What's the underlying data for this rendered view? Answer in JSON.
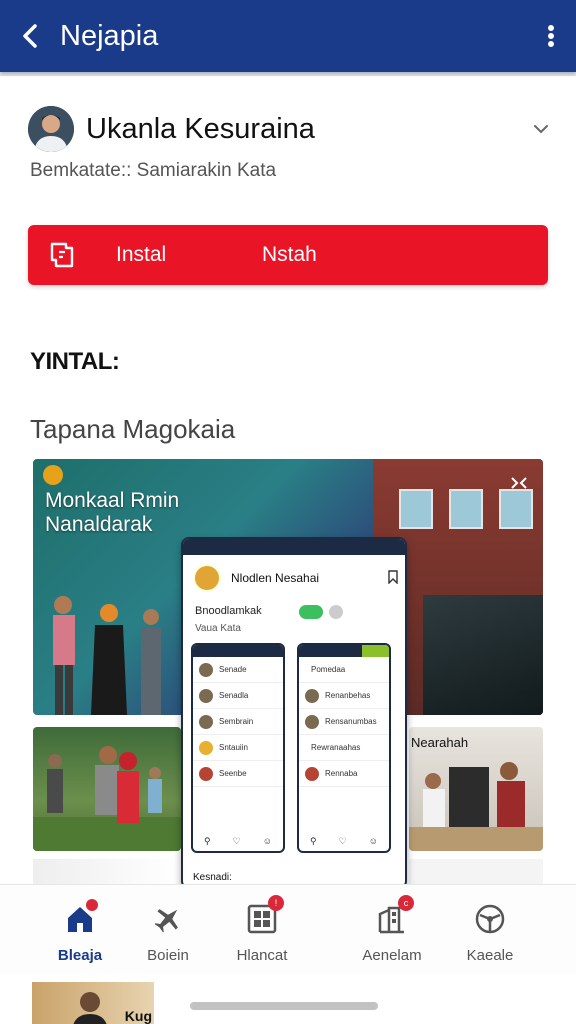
{
  "topbar": {
    "title": "Nejapia",
    "back_icon": "chevron-left-icon",
    "more_icon": "more-vertical-icon"
  },
  "app": {
    "name": "Ukanla Kesuraina",
    "subtitle": "Bemkatate:: Samiarakin Kata",
    "expand_icon": "chevron-down-icon"
  },
  "install": {
    "label": "Instal",
    "secondary_label": "Nstah",
    "color": "#ea1427",
    "icon": "install-icon"
  },
  "section": {
    "heading": "YINTAL:",
    "subheading": "Tapana Magokaia"
  },
  "gallery": {
    "main_photo_title_line1": "Monkaal Rmin",
    "main_photo_title_line2": "Nanaldarak",
    "right_photo_title": "Nearahah",
    "phone": {
      "name": "Nlodlen Nesahai",
      "line1": "Bnoodlamkak",
      "line2": "Vaua Kata",
      "footer": "Kesnadi:",
      "left_list": [
        "Senade",
        "Senadla",
        "Sembrain",
        "Sntauiin",
        "Seenbe"
      ],
      "right_list": [
        "Pomedaa",
        "Renanbehas",
        "Rensanumbas",
        "Rewranaahas",
        "Rennaba"
      ]
    }
  },
  "bottom_nav": [
    {
      "label": "Bleaja",
      "icon": "home-icon",
      "active": true,
      "badge": ""
    },
    {
      "label": "Boiein",
      "icon": "plane-icon",
      "active": false,
      "badge": ""
    },
    {
      "label": "Hlancat",
      "icon": "grid-icon",
      "active": false,
      "badge": "!"
    },
    {
      "label": "Aenelam",
      "icon": "building-icon",
      "active": false,
      "badge": "c"
    },
    {
      "label": "Kaeale",
      "icon": "steering-wheel-icon",
      "active": false,
      "badge": ""
    }
  ],
  "peek": {
    "text": "Kug"
  },
  "colors": {
    "brand_blue": "#1a3a8a",
    "accent_red": "#ea1427"
  }
}
